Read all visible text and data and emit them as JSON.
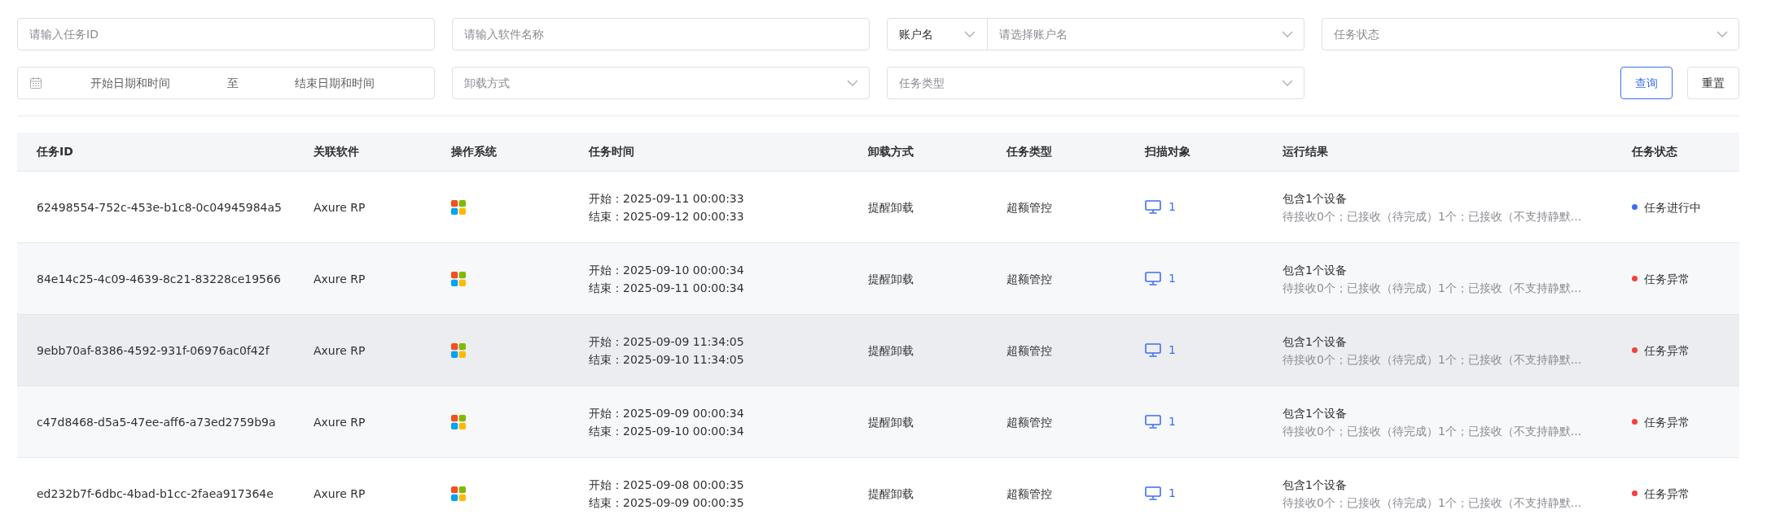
{
  "filters": {
    "rows": [
      [
        {
          "kind": "input",
          "placeholder": "请输入任务ID"
        },
        {
          "kind": "input",
          "placeholder": "请输入软件名称"
        },
        {
          "kind": "account",
          "value": "账户名",
          "placeholder": "请选择账户名"
        },
        {
          "kind": "select",
          "placeholder": "任务状态"
        }
      ],
      [
        {
          "kind": "daterange",
          "start_placeholder": "开始日期和时间",
          "separator": "至",
          "end_placeholder": "结束日期和时间"
        },
        {
          "kind": "select",
          "placeholder": "卸载方式"
        },
        {
          "kind": "select",
          "placeholder": "任务类型"
        }
      ]
    ],
    "buttons": [
      {
        "kind": "primary",
        "label": "查询"
      },
      {
        "kind": "default",
        "label": "重置"
      }
    ]
  },
  "table": {
    "columns": [
      "任务ID",
      "关联软件",
      "操作系统",
      "任务时间",
      "卸载方式",
      "任务类型",
      "扫描对象",
      "运行结果",
      "任务状态"
    ],
    "rows": [
      {
        "highlighted": false,
        "id": "62498554-752c-453e-b1c8-0c04945984a5",
        "software": "Axure RP",
        "start": "开始：2025-09-11 00:00:33",
        "end": "结束：2025-09-12 00:00:33",
        "uninstall": "提醒卸载",
        "type": "超额管控",
        "scan_count": "1",
        "result_title": "包含1个设备",
        "result_detail": "待接收0个；已接收（待完成）1个；已接收（不支持静默...",
        "status": "任务进行中",
        "color": "#3b6ef5"
      },
      {
        "highlighted": false,
        "id": "84e14c25-4c09-4639-8c21-83228ce19566",
        "software": "Axure RP",
        "start": "开始：2025-09-10 00:00:34",
        "end": "结束：2025-09-11 00:00:34",
        "uninstall": "提醒卸载",
        "type": "超额管控",
        "scan_count": "1",
        "result_title": "包含1个设备",
        "result_detail": "待接收0个；已接收（待完成）1个；已接收（不支持静默...",
        "status": "任务异常",
        "color": "#f5403d"
      },
      {
        "highlighted": true,
        "id": "9ebb70af-8386-4592-931f-06976ac0f42f",
        "software": "Axure RP",
        "start": "开始：2025-09-09 11:34:05",
        "end": "结束：2025-09-10 11:34:05",
        "uninstall": "提醒卸载",
        "type": "超额管控",
        "scan_count": "1",
        "result_title": "包含1个设备",
        "result_detail": "待接收0个；已接收（待完成）1个；已接收（不支持静默...",
        "status": "任务异常",
        "color": "#f5403d"
      },
      {
        "highlighted": false,
        "id": "c47d8468-d5a5-47ee-aff6-a73ed2759b9a",
        "software": "Axure RP",
        "start": "开始：2025-09-09 00:00:34",
        "end": "结束：2025-09-10 00:00:34",
        "uninstall": "提醒卸载",
        "type": "超额管控",
        "scan_count": "1",
        "result_title": "包含1个设备",
        "result_detail": "待接收0个；已接收（待完成）1个；已接收（不支持静默...",
        "status": "任务异常",
        "color": "#f5403d"
      },
      {
        "highlighted": false,
        "id": "ed232b7f-6dbc-4bad-b1cc-2faea917364e",
        "software": "Axure RP",
        "start": "开始：2025-09-08 00:00:35",
        "end": "结束：2025-09-09 00:00:35",
        "uninstall": "提醒卸载",
        "type": "超额管控",
        "scan_count": "1",
        "result_title": "包含1个设备",
        "result_detail": "待接收0个；已接收（待完成）1个；已接收（不支持静默...",
        "status": "任务异常",
        "color": "#f5403d"
      }
    ]
  }
}
